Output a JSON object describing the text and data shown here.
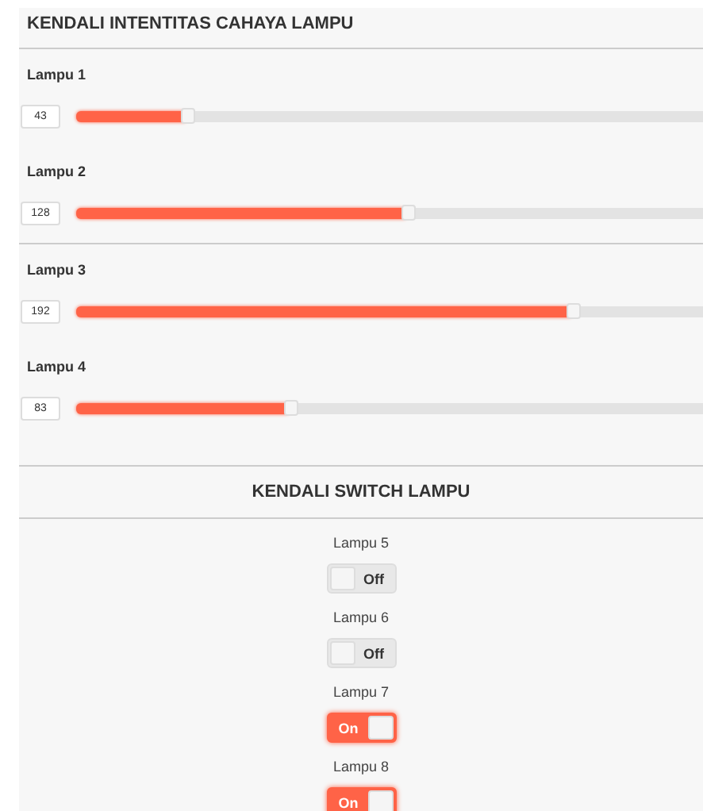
{
  "intensity_panel": {
    "title": "KENDALI INTENTITAS CAHAYA LAMPU",
    "sliders": [
      {
        "label": "Lampu 1",
        "value": "43",
        "level": 0.169
      },
      {
        "label": "Lampu 2",
        "value": "128",
        "level": 0.502
      },
      {
        "label": "Lampu 3",
        "value": "192",
        "level": 0.753
      },
      {
        "label": "Lampu 4",
        "value": "83",
        "level": 0.325
      }
    ]
  },
  "switch_panel": {
    "title": "KENDALI SWITCH LAMPU",
    "switches": [
      {
        "label": "Lampu 5",
        "on": false,
        "text": "Off"
      },
      {
        "label": "Lampu 6",
        "on": false,
        "text": "Off"
      },
      {
        "label": "Lampu 7",
        "on": true,
        "text": "On"
      },
      {
        "label": "Lampu 8",
        "on": true,
        "text": "On"
      }
    ]
  }
}
